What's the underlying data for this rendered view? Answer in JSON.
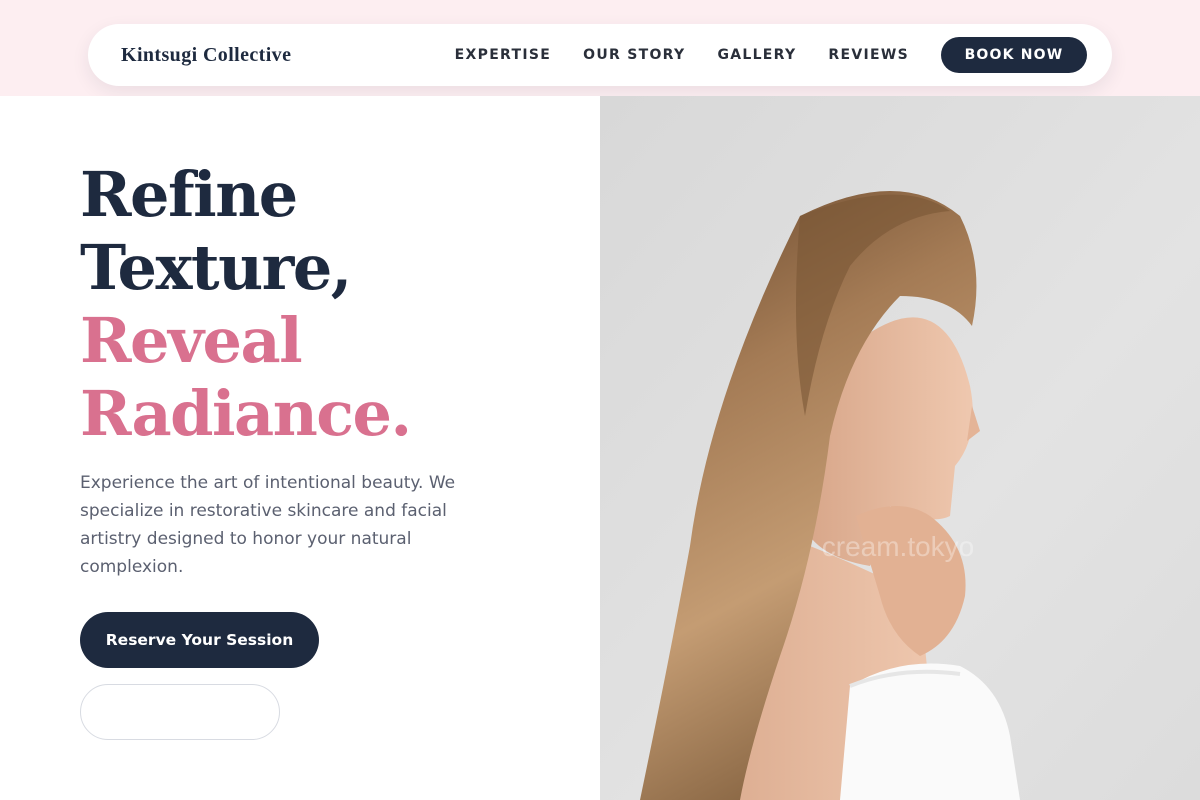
{
  "nav": {
    "brand": "Kintsugi Collective",
    "links": [
      "EXPERTISE",
      "OUR STORY",
      "GALLERY",
      "REVIEWS"
    ],
    "book_label": "BOOK NOW"
  },
  "hero": {
    "headline_line1": "Refine",
    "headline_line2": "Texture,",
    "headline_line3": "Reveal",
    "headline_line4": "Radiance.",
    "description": "Experience the art of intentional beauty. We specialize in restorative skincare and facial artistry designed to honor your natural complexion.",
    "primary_cta": "Reserve Your Session",
    "secondary_cta": "",
    "photo_watermark": "cream.tokyo"
  },
  "colors": {
    "navy": "#1e2a3f",
    "rose": "#d9718f",
    "blush_band": "#fdeef1",
    "photo_backdrop": "#dcdcdc"
  }
}
